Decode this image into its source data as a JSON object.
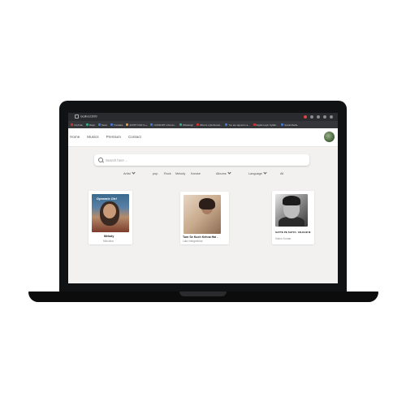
{
  "browser": {
    "url": "localhost:3000",
    "bookmarks": [
      {
        "label": "YouTube",
        "color": "#cc3333"
      },
      {
        "label": "Maps",
        "color": "#3a88aa"
      },
      {
        "label": "News",
        "color": "#4477cc"
      },
      {
        "label": "Translate",
        "color": "#4477cc"
      },
      {
        "label": "46 PPT FOR C++",
        "color": "#dd9944"
      },
      {
        "label": "CONSORT: Informin...",
        "color": "#4477cc"
      },
      {
        "label": "WhatsApp",
        "color": "#33aa88"
      },
      {
        "label": "What is cyberbrowsi...",
        "color": "#cc3333"
      },
      {
        "label": "You are signed in a...",
        "color": "#4477cc"
      },
      {
        "label": "Digital Logic: Syllab...",
        "color": "#cc3333"
      },
      {
        "label": "Social Media",
        "color": "#4477cc"
      }
    ]
  },
  "nav": {
    "links": [
      "Home",
      "Musics",
      "Premium",
      "Contact"
    ]
  },
  "search": {
    "placeholder": "Search here ..."
  },
  "filters": {
    "artist": "Artist",
    "genres": [
      "pop",
      "Rock",
      "Melody",
      "Karoke"
    ],
    "albums": "Albums",
    "language": "Language",
    "other": "All"
  },
  "cards": [
    {
      "title": "Melody",
      "subtitle": "Melodica",
      "image_overlay": "Dynamic Girl"
    },
    {
      "title": "Tum Se Kuch Kehna Hai -",
      "subtitle": "Lata mangeshkar"
    },
    {
      "title": "SATTE PE SATTA : DILBAR M",
      "subtitle": "Kishor Kumar"
    }
  ]
}
